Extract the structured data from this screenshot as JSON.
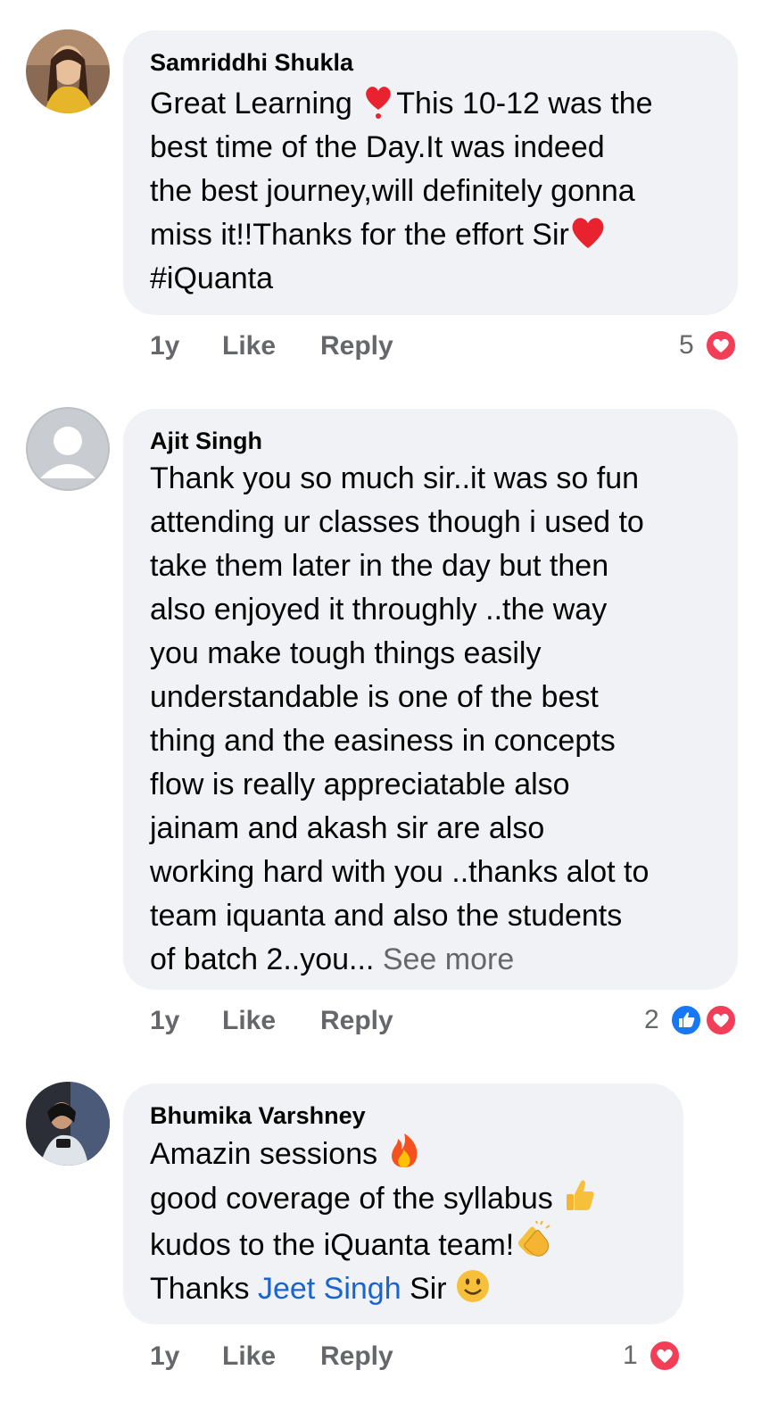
{
  "comments": [
    {
      "author": "Samriddhi Shukla",
      "lines": [
        {
          "before": "Great Learning ",
          "after": "This 10-12 was the"
        },
        "best time of the Day.It was indeed",
        "the best journey,will definitely gonna",
        {
          "before": "miss it!!Thanks for the effort Sir",
          "after": ""
        },
        "#iQuanta"
      ],
      "time": "1y",
      "like": "Like",
      "reply": "Reply",
      "reaction_count": "5",
      "reactions": [
        "love-icon"
      ]
    },
    {
      "author": "Ajit Singh",
      "lines": [
        "Thank you so much sir..it was so fun",
        "attending ur classes though i used to",
        "take them later in the day but then",
        "also enjoyed it throughly ..the way",
        "you make tough things easily",
        "understandable is one of the best",
        "thing and the easiness  in concepts",
        "flow is really appreciatable  also",
        "jainam and akash sir are also",
        "working hard with you ..thanks alot to",
        "team iquanta and also the students"
      ],
      "last_line": "of batch 2..you... ",
      "see_more": "See more",
      "time": "1y",
      "like": "Like",
      "reply": "Reply",
      "reaction_count": "2",
      "reactions": [
        "like-icon",
        "love-icon"
      ]
    },
    {
      "author": "Bhumika Varshney",
      "line1": "Amazin sessions ",
      "line2": "good coverage of the syllabus ",
      "line3": "kudos to the iQuanta team!",
      "line4_before": "Thanks ",
      "mention": "Jeet Singh",
      "line4_after": " Sir ",
      "time": "1y",
      "like": "Like",
      "reply": "Reply",
      "reaction_count": "1",
      "reactions": [
        "love-icon"
      ]
    }
  ],
  "colors": {
    "bubble": "#f0f2f5",
    "secondary_text": "#65676b",
    "mention": "#1a64d0",
    "love": "#f33e58",
    "like": "#1877f2"
  }
}
